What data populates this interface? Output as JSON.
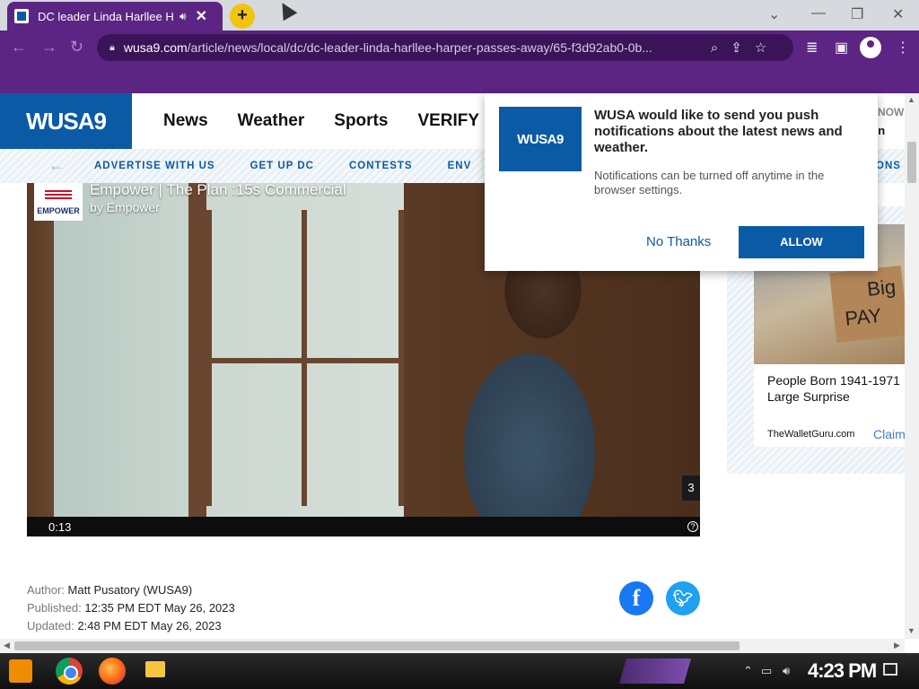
{
  "browser": {
    "tab_title": "DC leader Linda Harllee Harper passes away",
    "new_tab_symbol": "+",
    "url_host": "wusa9.com",
    "url_path": "/article/news/local/dc/dc-leader-linda-harllee-harper-passes-away/65-f3d92ab0-0b..."
  },
  "site": {
    "logo_text": "WUSA9",
    "nav": [
      "News",
      "Weather",
      "Sports",
      "VERIFY"
    ],
    "header_right_top": "NOW",
    "header_right_bottom": "gton",
    "subnav": [
      "ADVERTISE WITH US",
      "GET UP DC",
      "CONTESTS",
      "ENV"
    ],
    "subnav_tail": "ONS"
  },
  "video": {
    "sponsor_logo": "EMPOWER",
    "title": "Empower | The Plan :15s Commercial",
    "by": "by Empower",
    "countdown": "3",
    "time": "0:13"
  },
  "article": {
    "author_label": "Author:",
    "author": "Matt Pusatory (WUSA9)",
    "published_label": "Published:",
    "published": "12:35 PM EDT May 26, 2023",
    "updated_label": "Updated:",
    "updated": "2:48 PM EDT May 26, 2023"
  },
  "ad": {
    "sign_top": "Big",
    "sign_bottom": "PAY",
    "headline": "People Born 1941-1971 Large Surprise",
    "source": "TheWalletGuru.com",
    "cta": "Claim"
  },
  "push": {
    "logo_text": "WUSA9",
    "title": "WUSA would like to send you push notifications about the latest news and weather.",
    "body": "Notifications can be turned off anytime in the browser settings.",
    "decline": "No Thanks",
    "accept": "ALLOW"
  },
  "taskbar": {
    "clock": "4:23 PM"
  },
  "colors": {
    "brand_blue": "#0b5aa6",
    "browser_purple": "#5c2483",
    "facebook": "#1877f2",
    "twitter": "#1da1f2"
  }
}
